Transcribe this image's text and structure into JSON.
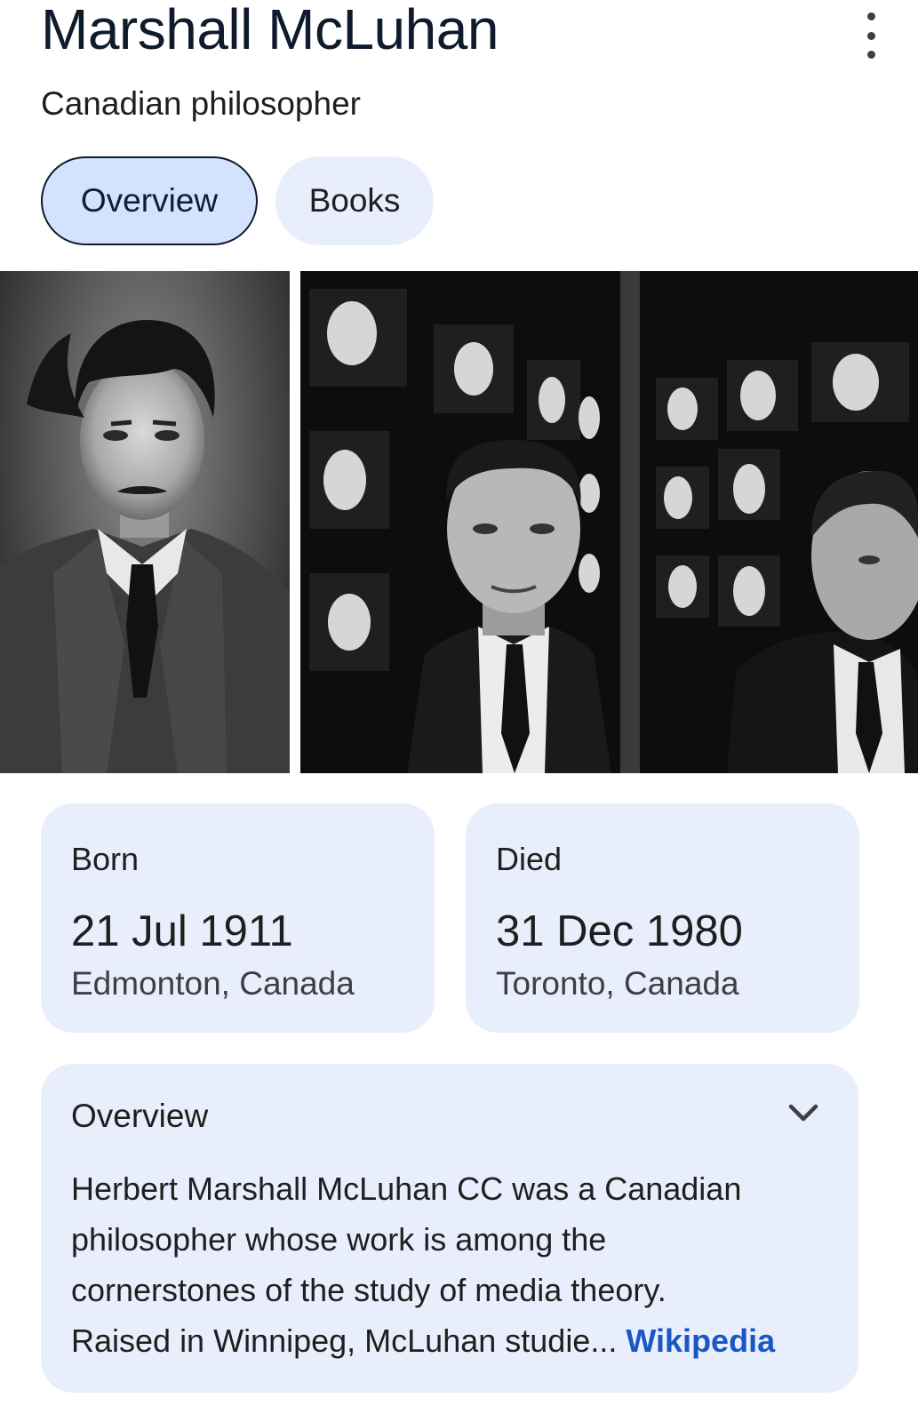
{
  "header": {
    "title": "Marshall McLuhan",
    "subtitle": "Canadian philosopher",
    "more_icon": "more-vert-icon"
  },
  "tabs": [
    {
      "label": "Overview",
      "active": true
    },
    {
      "label": "Books",
      "active": false
    }
  ],
  "gallery": {
    "images": [
      {
        "name": "portrait-photo"
      },
      {
        "name": "tv-wall-photo"
      }
    ]
  },
  "facts": {
    "born": {
      "label": "Born",
      "date": "21 Jul 1911",
      "place": "Edmonton, Canada"
    },
    "died": {
      "label": "Died",
      "date": "31 Dec 1980",
      "place": "Toronto, Canada"
    }
  },
  "overview": {
    "heading": "Overview",
    "text_lines": [
      "Herbert Marshall McLuhan CC was a Canadian",
      "philosopher whose work is among the",
      "cornerstones of the study of media theory.",
      "Raised in Winnipeg, McLuhan studie"
    ],
    "ellipsis": "...",
    "source_link": "Wikipedia",
    "chevron_icon": "chevron-down-icon"
  },
  "colors": {
    "card_bg": "#e8eefb",
    "active_tab_bg": "#d3e3fd",
    "link": "#1a56c4"
  }
}
